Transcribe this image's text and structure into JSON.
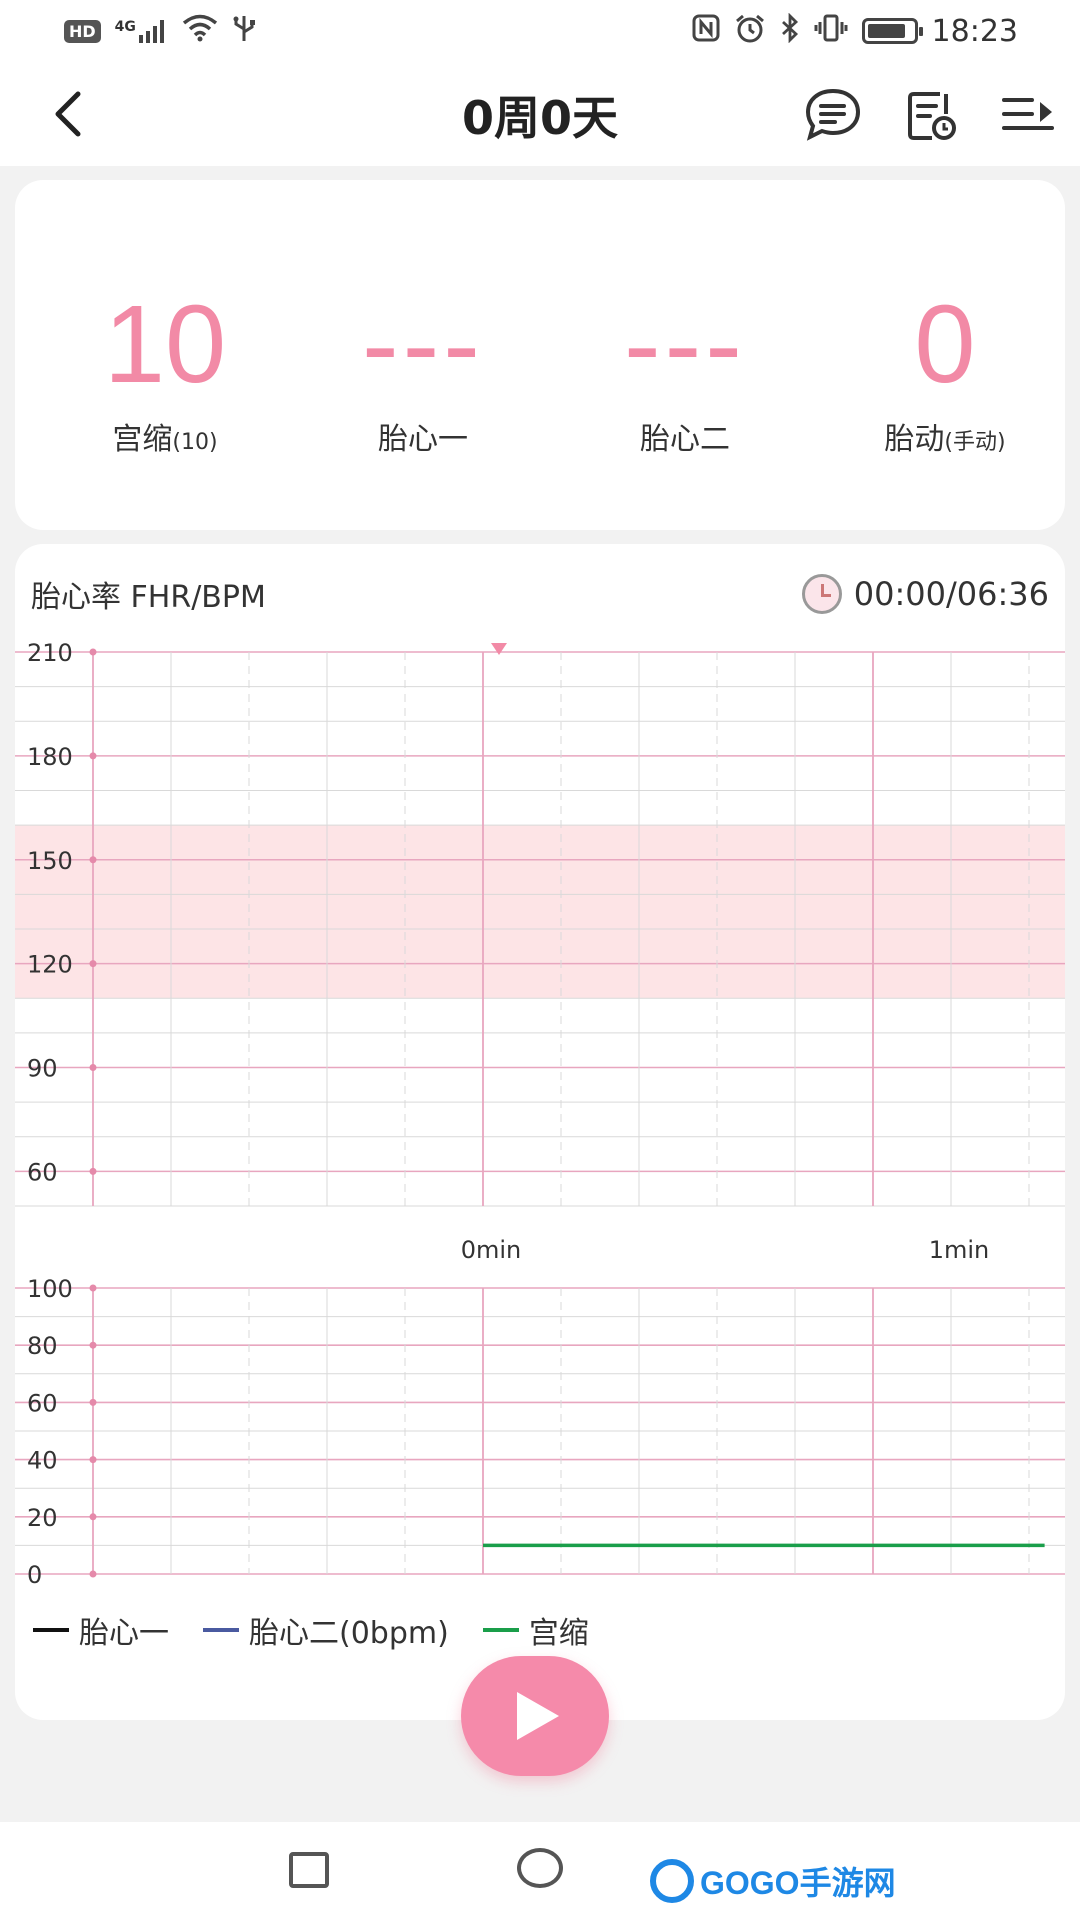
{
  "status_bar": {
    "hd": "HD",
    "network": "4G",
    "time": "18:23",
    "left_icons": [
      "signal-icon",
      "wifi-icon",
      "usb-icon"
    ],
    "right_icons": [
      "nfc-icon",
      "alarm-icon",
      "bluetooth-icon",
      "vibrate-icon",
      "battery-icon"
    ]
  },
  "header": {
    "title": "0周0天",
    "icons": [
      "back-icon",
      "message-icon",
      "record-list-icon",
      "menu-expand-icon"
    ]
  },
  "stats": {
    "contraction": {
      "value": "10",
      "label": "宫缩",
      "sub": "(10)"
    },
    "fhr1": {
      "value": "---",
      "label": "胎心一"
    },
    "fhr2": {
      "value": "---",
      "label": "胎心二"
    },
    "movement": {
      "value": "0",
      "label": "胎动",
      "sub": "(手动)"
    }
  },
  "chart_header": {
    "title": "胎心率 FHR/BPM",
    "timer": "00:00/06:36"
  },
  "colors": {
    "accent": "#f28aa6",
    "grid_pink": "#e8a6bf",
    "safe_band": "#fde4e6",
    "fhr1_line": "#111111",
    "fhr2_line": "#4a5aa0",
    "toco_line": "#1a9e4a"
  },
  "chart_data": [
    {
      "type": "line",
      "ylabel": "FHR/BPM",
      "ylim": [
        50,
        210
      ],
      "yticks": [
        "210",
        "180",
        "150",
        "120",
        "90",
        "60"
      ],
      "normal_range": [
        110,
        160
      ],
      "series": []
    },
    {
      "type": "line",
      "ylim": [
        0,
        100
      ],
      "yticks": [
        "100",
        "80",
        "60",
        "40",
        "20",
        "0"
      ],
      "xticks": [
        "0min",
        "1min"
      ],
      "x": [
        0,
        1.2
      ],
      "series": [
        {
          "name": "宫缩",
          "values": [
            10,
            10
          ]
        }
      ]
    }
  ],
  "legend": [
    {
      "label": "胎心一",
      "color": "#111111"
    },
    {
      "label": "胎心二(0bpm)",
      "color": "#4a5aa0"
    },
    {
      "label": "宫缩",
      "color": "#1a9e4a"
    }
  ],
  "nav": {
    "watermark": "GOGO手游网"
  }
}
